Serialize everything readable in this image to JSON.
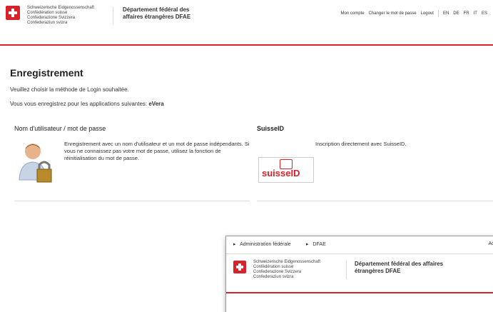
{
  "header": {
    "confederation_lines": [
      "Schweizerische Eidgenossenschaft",
      "Confédération suisse",
      "Confederazione Svizzera",
      "Confederaziun svizra"
    ],
    "department": "Département fédéral des affaires étrangères DFAE",
    "links": [
      "Mon compte",
      "Changer le mot de passe",
      "Logout"
    ],
    "languages": [
      "EN",
      "DE",
      "FR",
      "IT",
      "ES"
    ]
  },
  "main": {
    "title": "Enregistrement",
    "intro": "Veuillez choisir la méthode de Login souhaitée.",
    "apps_prefix": "Vous vous enregistrez pour les applications suivantes:",
    "apps_name": "eVera",
    "username": {
      "heading": "Nom d'utilisateur / mot de passe",
      "description": "Enregistrement avec un nom d'utilisateur et un mot de passe indépendants. Si vous ne connaissez pas votre mot de passe, utilisez la fonction de réinitialisation du mot de passe."
    },
    "suisseid": {
      "heading": "SuisseID",
      "description": "Inscription directement avec SuisseID.",
      "logo_text": "suisseID"
    }
  },
  "overlay": {
    "breadcrumb": [
      "Administration fédérale",
      "DFAE"
    ],
    "right_text": "Ad",
    "confederation_lines": [
      "Schweizerische Eidgenossenschaft",
      "Confédération suisse",
      "Confederazione Svizzera",
      "Confederaziun svizra"
    ],
    "department": "Département fédéral des affaires étrangères DFAE"
  }
}
